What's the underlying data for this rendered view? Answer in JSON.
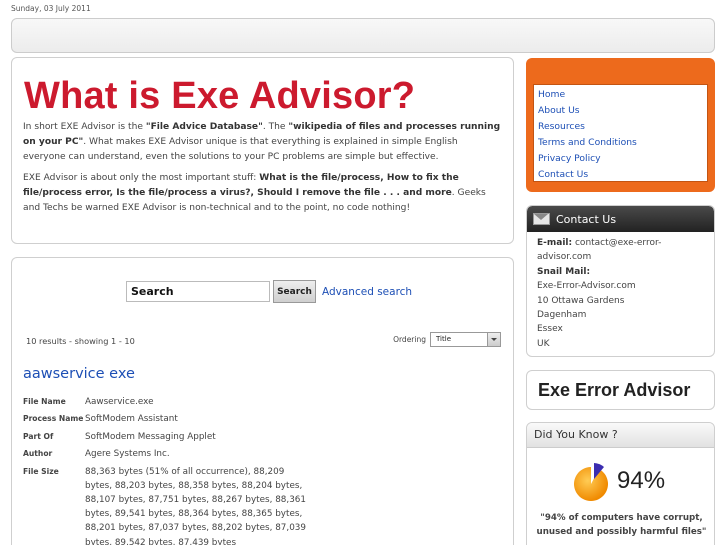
{
  "date": "Sunday, 03 July 2011",
  "intro": {
    "title": "What is Exe Advisor?",
    "p1_a": "In short EXE Advisor is the ",
    "p1_b": "\"File Advice Database\"",
    "p1_c": ". The ",
    "p1_d": "\"wikipedia of files and processes running on your PC\"",
    "p1_e": ". What makes EXE Advisor unique is that everything is explained in simple English everyone can understand, even the solutions to your PC problems are simple but effective.",
    "p2_a": "EXE Advisor is about only the most important stuff: ",
    "p2_b": "What is the file/process, How to fix the file/process error, Is the file/process a virus?, Should I remove the file . . . and more",
    "p2_c": ". Geeks and Techs be warned EXE Advisor is non-technical and to the point, no code nothing!"
  },
  "search": {
    "value": "Search",
    "button": "Search",
    "advanced": "Advanced search"
  },
  "results": {
    "count": "10 results - showing 1 - 10",
    "ordering_label": "Ordering",
    "ordering_value": "Title",
    "item": {
      "title": "aawservice exe",
      "fields": [
        {
          "label": "File Name",
          "value": "Aawservice.exe"
        },
        {
          "label": "Process Name",
          "value": "SoftModem Assistant"
        },
        {
          "label": "Part Of",
          "value": "SoftModem Messaging Applet"
        },
        {
          "label": "Author",
          "value": "Agere Systems Inc."
        },
        {
          "label": "File Size",
          "value": "88,363 bytes (51% of all occurrence), 88,209 bytes, 88,203 bytes, 88,358 bytes, 88,204 bytes, 88,107 bytes, 87,751 bytes, 88,267 bytes, 88,361 bytes, 89,541 bytes, 88,364 bytes, 88,365 bytes, 88,201 bytes, 87,037 bytes, 88,202 bytes, 87,039 bytes, 89,542 bytes, 87,439 bytes"
        }
      ]
    }
  },
  "menu": {
    "items": [
      "Home",
      "About Us",
      "Resources",
      "Terms and Conditions",
      "Privacy Policy",
      "Contact Us"
    ]
  },
  "contact": {
    "title": "Contact Us",
    "email_label": "E-mail:",
    "email": "contact@exe-error-advisor.com",
    "mail_label": "Snail Mail:",
    "address": [
      "Exe-Error-Advisor.com",
      "10 Ottawa Gardens",
      "Dagenham",
      "Essex",
      "UK"
    ]
  },
  "brand": "Exe Error Advisor",
  "know": {
    "title": "Did You Know ?",
    "percent": "94%",
    "text": "\"94% of computers have corrupt, unused and possibly harmful files\""
  },
  "colors": {
    "accent_red": "#cc1a2e",
    "link_blue": "#1d4fb5",
    "menu_orange": "#ed6a1c"
  }
}
